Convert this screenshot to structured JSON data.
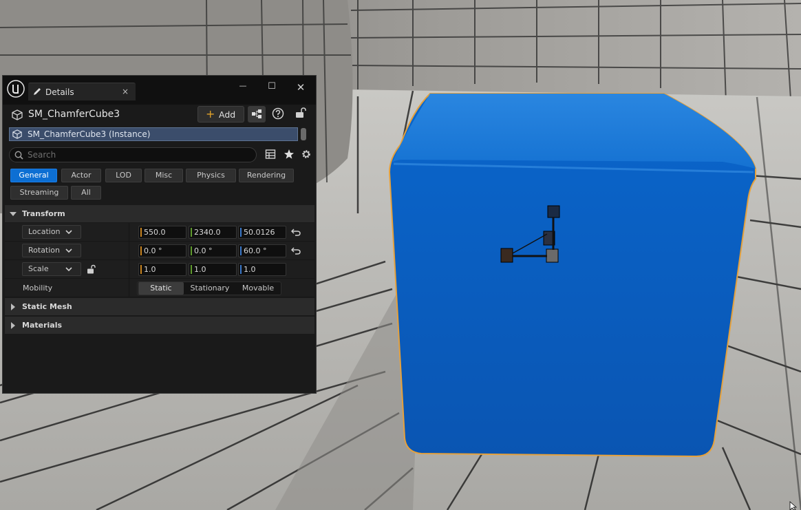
{
  "window": {
    "tab_title": "Details",
    "close_glyph": "×",
    "min_glyph": "—",
    "max_glyph": "☐",
    "winclose_glyph": "✕"
  },
  "actor": {
    "name": "SM_ChamferCube3",
    "add_label": "Add",
    "add_glyph": "+"
  },
  "components": {
    "instance_label": "SM_ChamferCube3 (Instance)"
  },
  "search": {
    "placeholder": "Search"
  },
  "filters": [
    {
      "label": "General",
      "active": true
    },
    {
      "label": "Actor"
    },
    {
      "label": "LOD"
    },
    {
      "label": "Misc"
    },
    {
      "label": "Physics"
    },
    {
      "label": "Rendering"
    },
    {
      "label": "Streaming"
    },
    {
      "label": "All"
    }
  ],
  "sections": {
    "transform": "Transform",
    "static_mesh": "Static Mesh",
    "materials": "Materials"
  },
  "transform": {
    "location": {
      "label": "Location",
      "x": "550.0",
      "y": "2340.0",
      "z": "50.0126"
    },
    "rotation": {
      "label": "Rotation",
      "x": "0.0 °",
      "y": "0.0 °",
      "z": "60.0 °"
    },
    "scale": {
      "label": "Scale",
      "x": "1.0",
      "y": "1.0",
      "z": "1.0"
    },
    "mobility": {
      "label": "Mobility",
      "options": [
        "Static",
        "Stationary",
        "Movable"
      ],
      "selected": "Static"
    }
  },
  "colors": {
    "accent": "#0d6fd3",
    "axis_x": "#c8841f",
    "axis_y": "#5f9a2d",
    "axis_z": "#3a78c9",
    "cube": "#0a63c9",
    "selection_outline": "#e6a13b"
  },
  "icons": {
    "logo": "unreal-logo-icon",
    "tab": "pencil-icon",
    "actor": "static-mesh-icon",
    "hierarchy": "hierarchy-icon",
    "help": "help-icon",
    "lock": "lock-open-icon",
    "search": "search-icon",
    "table": "table-view-icon",
    "favorite": "star-icon",
    "settings": "gear-icon",
    "reset": "reset-arrow-icon"
  }
}
